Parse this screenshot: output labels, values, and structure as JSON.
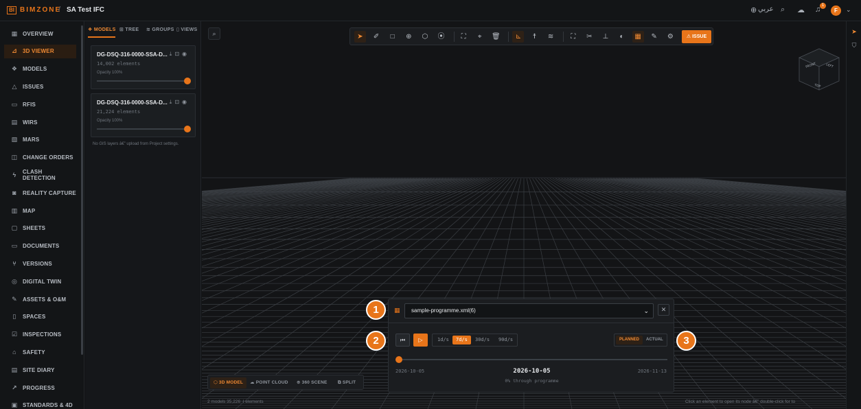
{
  "brand": {
    "mark": "BI",
    "name": "BIMZONE"
  },
  "header": {
    "separator": "/",
    "project": "SA Test IFC",
    "language": "عربي",
    "notifications_count": "1",
    "avatar_initial": "F"
  },
  "sidebar": {
    "items": [
      {
        "label": "OVERVIEW",
        "icon": "overview-icon",
        "glyph": "▦",
        "active": false
      },
      {
        "label": "3D VIEWER",
        "icon": "3d-viewer-icon",
        "glyph": "⊿",
        "active": true
      },
      {
        "label": "MODELS",
        "icon": "models-icon",
        "glyph": "❖",
        "active": false
      },
      {
        "label": "ISSUES",
        "icon": "issues-icon",
        "glyph": "△",
        "active": false
      },
      {
        "label": "RFIS",
        "icon": "rfis-icon",
        "glyph": "▭",
        "active": false
      },
      {
        "label": "WIRS",
        "icon": "wirs-icon",
        "glyph": "▤",
        "active": false
      },
      {
        "label": "MARS",
        "icon": "mars-icon",
        "glyph": "▧",
        "active": false
      },
      {
        "label": "CHANGE ORDERS",
        "icon": "change-orders-icon",
        "glyph": "◫",
        "active": false
      },
      {
        "label": "CLASH DETECTION",
        "icon": "clash-detection-icon",
        "glyph": "ϟ",
        "active": false
      },
      {
        "label": "REALITY CAPTURE",
        "icon": "reality-capture-icon",
        "glyph": "◙",
        "active": false
      },
      {
        "label": "MAP",
        "icon": "map-icon",
        "glyph": "▥",
        "active": false
      },
      {
        "label": "SHEETS",
        "icon": "sheets-icon",
        "glyph": "▢",
        "active": false
      },
      {
        "label": "DOCUMENTS",
        "icon": "documents-icon",
        "glyph": "▭",
        "active": false
      },
      {
        "label": "VERSIONS",
        "icon": "versions-icon",
        "glyph": "⑂",
        "active": false
      },
      {
        "label": "DIGITAL TWIN",
        "icon": "digital-twin-icon",
        "glyph": "◎",
        "active": false
      },
      {
        "label": "ASSETS & O&M",
        "icon": "assets-icon",
        "glyph": "✎",
        "active": false
      },
      {
        "label": "SPACES",
        "icon": "spaces-icon",
        "glyph": "▯",
        "active": false
      },
      {
        "label": "INSPECTIONS",
        "icon": "inspections-icon",
        "glyph": "☑",
        "active": false
      },
      {
        "label": "SAFETY",
        "icon": "safety-icon",
        "glyph": "⌂",
        "active": false
      },
      {
        "label": "SITE DIARY",
        "icon": "site-diary-icon",
        "glyph": "▤",
        "active": false
      },
      {
        "label": "PROGRESS",
        "icon": "progress-icon",
        "glyph": "↗",
        "active": false
      },
      {
        "label": "STANDARDS & 4D",
        "icon": "standards-icon",
        "glyph": "▣",
        "active": false
      }
    ]
  },
  "panel": {
    "tabs": [
      {
        "label": "MODELS",
        "icon": "models-tab-icon",
        "glyph": "❖",
        "active": true
      },
      {
        "label": "TREE",
        "icon": "tree-tab-icon",
        "glyph": "⊞",
        "active": false
      },
      {
        "label": "GROUPS",
        "icon": "groups-tab-icon",
        "glyph": "≋",
        "active": false
      },
      {
        "label": "VIEWS",
        "icon": "views-tab-icon",
        "glyph": "▯",
        "active": false
      }
    ],
    "models": [
      {
        "name": "DG-DSQ-316-0000-SSA-D...",
        "elements": "14,002 elements",
        "opacity": "Opacity 100%",
        "opacity_value": 1.0
      },
      {
        "name": "DG-DSQ-316-0000-SSA-D...",
        "elements": "21,224 elements",
        "opacity": "Opacity 100%",
        "opacity_value": 1.0
      }
    ],
    "gis_note": "No GIS layers â€” upload from Project settings."
  },
  "toolbar": {
    "tools": [
      {
        "icon": "select-icon",
        "glyph": "➤",
        "active": true
      },
      {
        "icon": "measure-icon",
        "glyph": "✐",
        "active": false
      },
      {
        "icon": "area-icon",
        "glyph": "□",
        "active": false
      },
      {
        "icon": "target-icon",
        "glyph": "⊕",
        "active": false
      },
      {
        "icon": "box-icon",
        "glyph": "⬡",
        "active": false
      },
      {
        "icon": "pin-icon",
        "glyph": "⦿",
        "active": false
      },
      {
        "sep": true
      },
      {
        "icon": "fit-icon",
        "glyph": "⛶",
        "active": false
      },
      {
        "icon": "location-icon",
        "glyph": "⌖",
        "active": false
      },
      {
        "icon": "delete-icon",
        "glyph": "🗑",
        "active": false
      },
      {
        "sep": true
      },
      {
        "icon": "axes-icon",
        "glyph": "⊾",
        "active": true
      },
      {
        "icon": "walk-icon",
        "glyph": "☨",
        "active": false
      },
      {
        "icon": "layers-icon",
        "glyph": "≋",
        "active": false
      },
      {
        "sep": true
      },
      {
        "icon": "fullscreen-icon",
        "glyph": "⛶",
        "active": false
      },
      {
        "icon": "cut-icon",
        "glyph": "✂",
        "active": false
      },
      {
        "icon": "dimension-icon",
        "glyph": "⊥",
        "active": false
      },
      {
        "icon": "palette-icon",
        "glyph": "◐",
        "active": false
      },
      {
        "icon": "calendar-icon",
        "glyph": "▦",
        "active": true
      },
      {
        "icon": "pencil-icon",
        "glyph": "✎",
        "active": false
      },
      {
        "icon": "settings-icon",
        "glyph": "⚙",
        "active": false
      }
    ],
    "issue_label": "ISSUE",
    "issue_icon_glyph": "⚠"
  },
  "viewcube": {
    "left": "FRONT",
    "right": "LEFT",
    "top": "TOP"
  },
  "modes": [
    {
      "label": "3D MODEL",
      "icon": "3d-model-icon",
      "glyph": "⬡",
      "active": true
    },
    {
      "label": "POINT CLOUD",
      "icon": "point-cloud-icon",
      "glyph": "☁",
      "active": false
    },
    {
      "label": "360 SCENE",
      "icon": "360-scene-icon",
      "glyph": "⊕",
      "active": false
    },
    {
      "label": "SPLIT",
      "icon": "split-icon",
      "glyph": "⧉",
      "active": false
    }
  ],
  "status": {
    "left": "2 models 35,226 ·l elements",
    "right": "Click an element to open its node â€” double-click for to"
  },
  "schedule": {
    "file": "sample-programme.xml(6)",
    "speeds": [
      {
        "label": "1d/s",
        "active": false
      },
      {
        "label": "7d/s",
        "active": true
      },
      {
        "label": "30d/s",
        "active": false
      },
      {
        "label": "90d/s",
        "active": false
      }
    ],
    "modes": [
      {
        "label": "PLANNED",
        "active": true
      },
      {
        "label": "ACTUAL",
        "active": false
      }
    ],
    "start_date": "2026-10-05",
    "current_date": "2026-10-05",
    "end_date": "2026-11-13",
    "progress_text": "0% through programme",
    "progress_value": 0
  },
  "callouts": [
    "1",
    "2",
    "3"
  ],
  "colors": {
    "accent": "#e8751a",
    "background": "#111315",
    "panel": "#1b1d20"
  }
}
